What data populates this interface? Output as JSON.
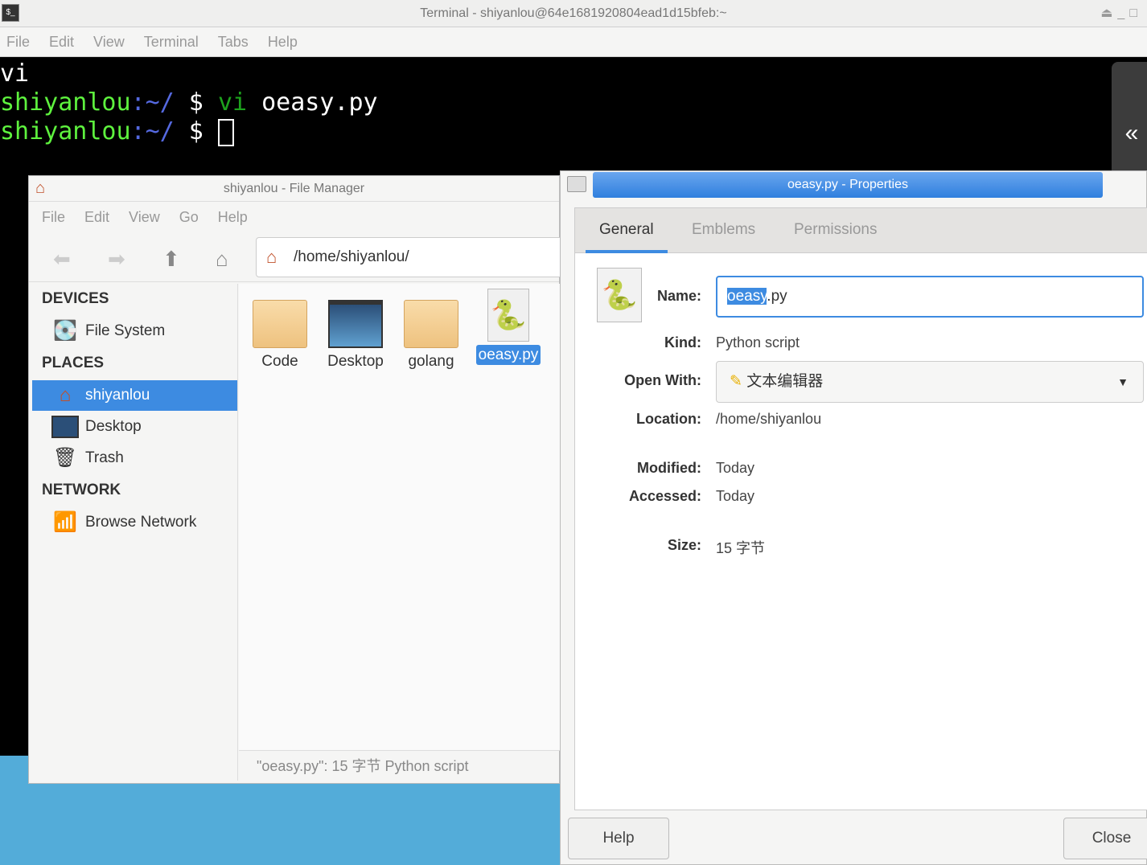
{
  "terminal": {
    "title": "Terminal - shiyanlou@64e1681920804ead1d15bfeb:~",
    "menu": [
      "File",
      "Edit",
      "View",
      "Terminal",
      "Tabs",
      "Help"
    ],
    "lines": {
      "l1": "vi",
      "user": "shiyanlou",
      "path": ":~/",
      "prompt": " $ ",
      "cmd": "vi",
      "arg": " oeasy.py"
    }
  },
  "side_panel": {
    "icon": "double-chevron-left-icon",
    "glyph": "«"
  },
  "file_manager": {
    "title": "shiyanlou - File Manager",
    "menu": [
      "File",
      "Edit",
      "View",
      "Go",
      "Help"
    ],
    "path": "/home/shiyanlou/",
    "sections": {
      "devices": "DEVICES",
      "places": "PLACES",
      "network": "NETWORK"
    },
    "items": {
      "fs": "File System",
      "home": "shiyanlou",
      "desktop": "Desktop",
      "trash": "Trash",
      "net": "Browse Network"
    },
    "files": [
      "Code",
      "Desktop",
      "golang",
      "oeasy.py"
    ],
    "status": "\"oeasy.py\": 15 字节 Python script"
  },
  "properties": {
    "title": "oeasy.py - Properties",
    "tabs": [
      "General",
      "Emblems",
      "Permissions"
    ],
    "labels": {
      "name": "Name:",
      "kind": "Kind:",
      "open": "Open With:",
      "loc": "Location:",
      "mod": "Modified:",
      "acc": "Accessed:",
      "size": "Size:"
    },
    "name_sel": "oeasy",
    "name_rest": ".py",
    "kind": "Python script",
    "open_with": "文本编辑器",
    "location": "/home/shiyanlou",
    "modified": "Today",
    "accessed": "Today",
    "size": "15 字节",
    "help": "Help",
    "close": "Close"
  },
  "colors": {
    "accent": "#3d8be1",
    "prompt_user": "#5ef23e",
    "prompt_path": "#5569e0",
    "desktop": "#53acd9"
  }
}
